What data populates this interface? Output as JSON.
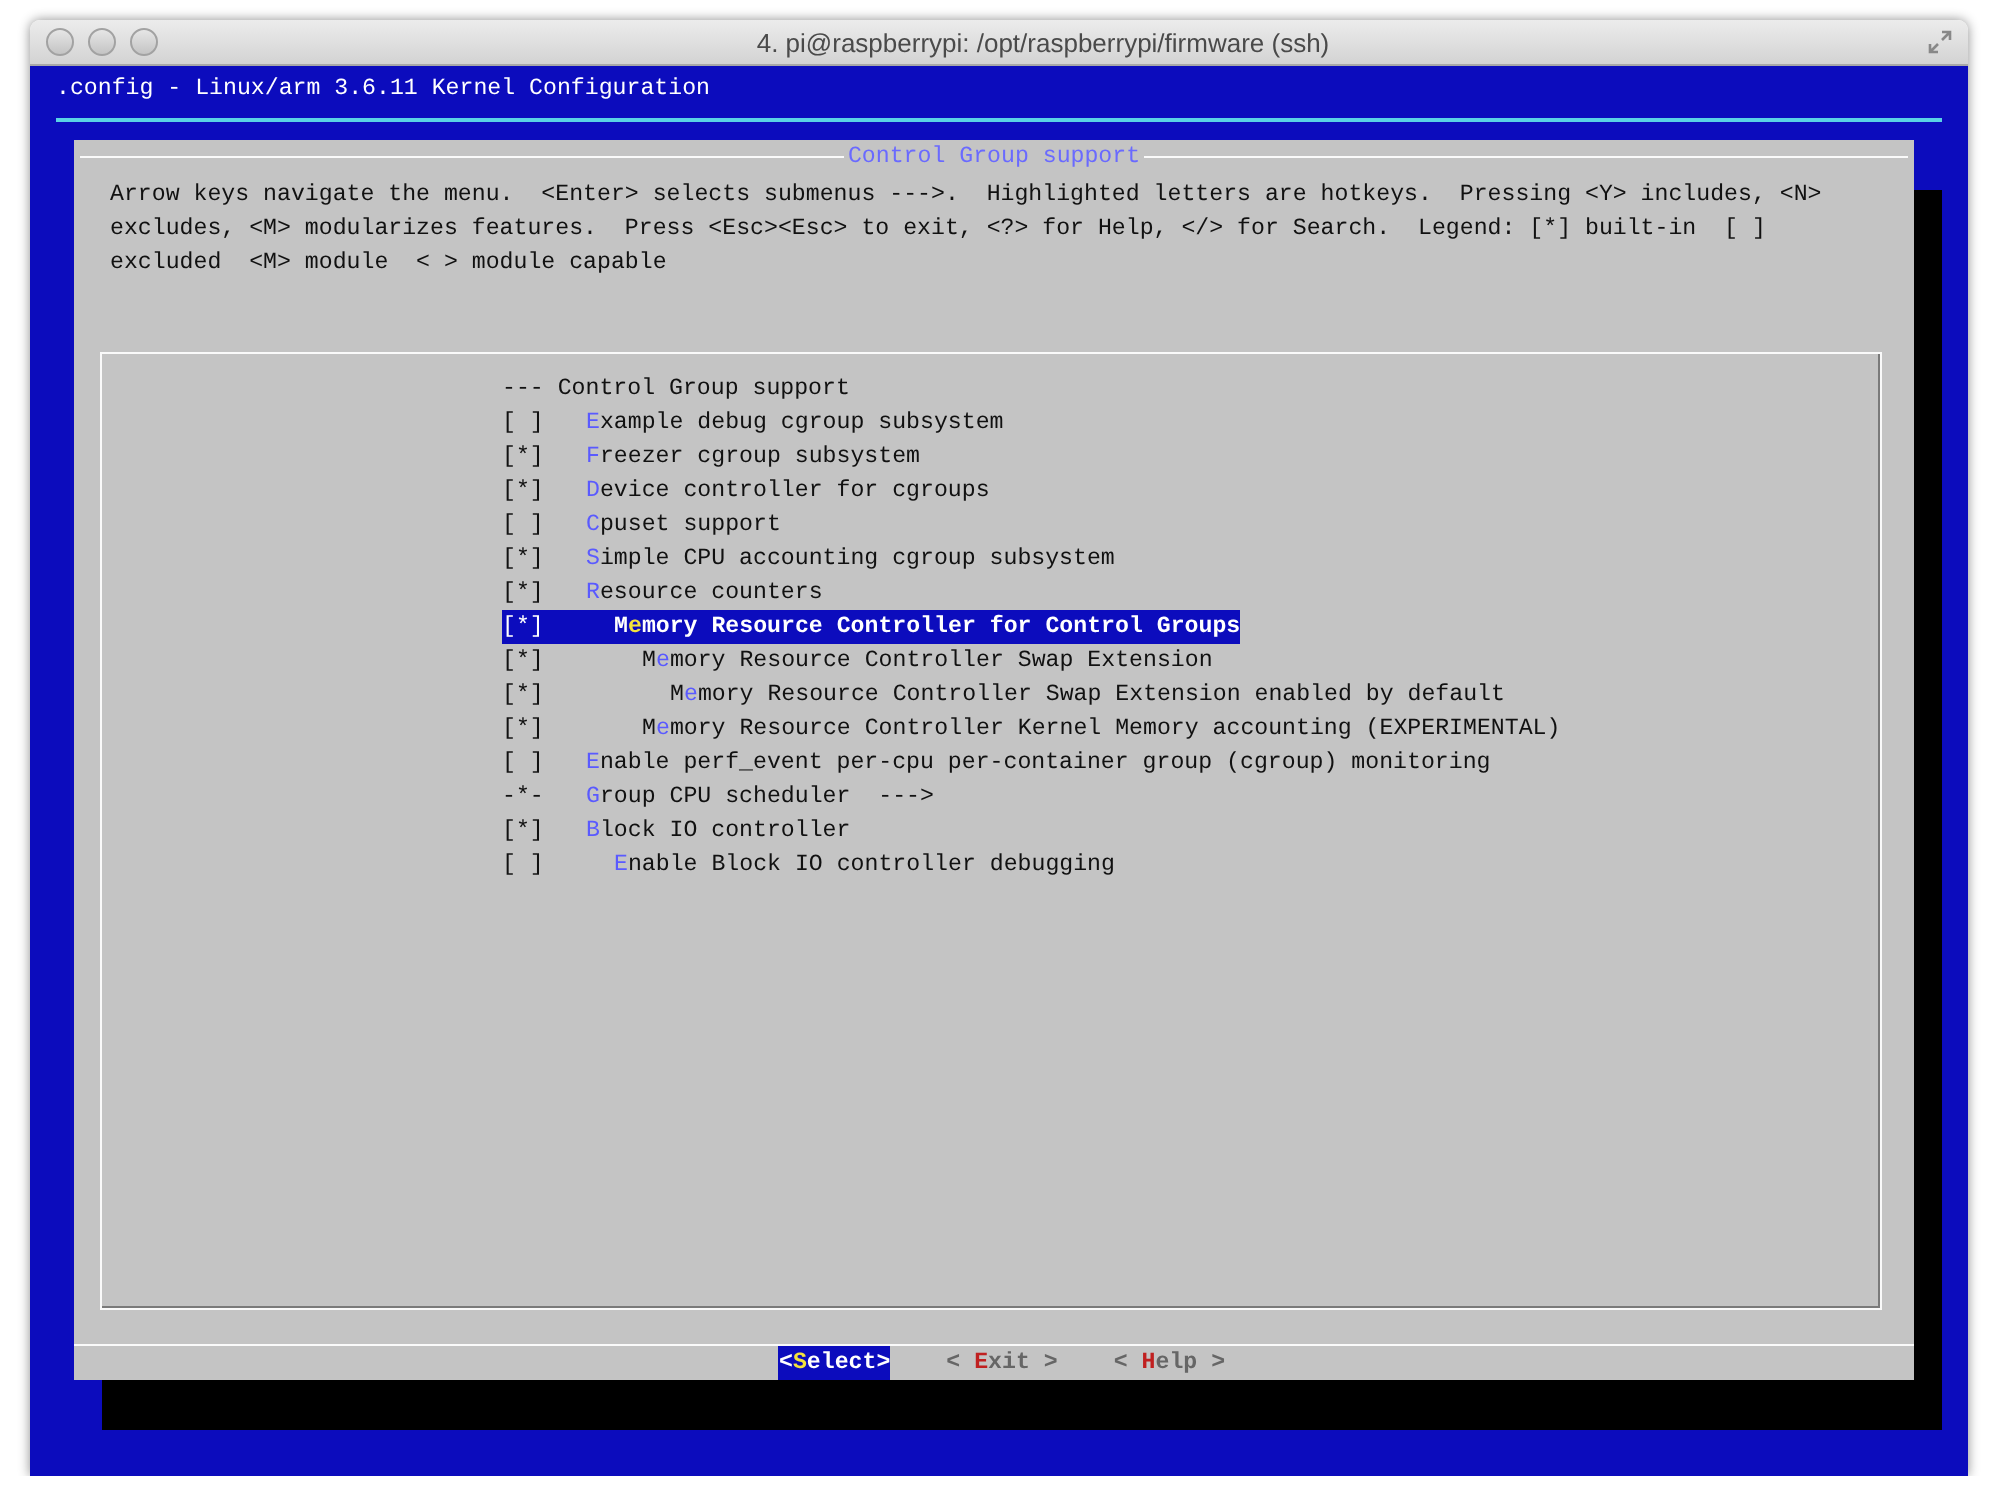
{
  "window": {
    "title": "4. pi@raspberrypi: /opt/raspberrypi/firmware (ssh)"
  },
  "header": ".config - Linux/arm 3.6.11 Kernel Configuration",
  "dialog": {
    "title": "Control Group support",
    "help": [
      "Arrow keys navigate the menu.  <Enter> selects submenus --->.  Highlighted letters are hotkeys.  Pressing <Y> includes, <N>",
      "excludes, <M> modularizes features.  Press <Esc><Esc> to exit, <?> for Help, </> for Search.  Legend: [*] built-in  [ ]",
      "excluded  <M> module  < > module capable"
    ],
    "menu": [
      {
        "mark": "---",
        "label": "Control Group support",
        "kind": "comment"
      },
      {
        "mark": "[ ]",
        "label": "**E**xample debug cgroup subsystem",
        "kind": "option",
        "selected": false
      },
      {
        "mark": "[*]",
        "label": "**F**reezer cgroup subsystem",
        "kind": "option",
        "selected": false
      },
      {
        "mark": "[*]",
        "label": "**D**evice controller for cgroups",
        "kind": "option",
        "selected": false
      },
      {
        "mark": "[ ]",
        "label": "**C**puset support",
        "kind": "option",
        "selected": false
      },
      {
        "mark": "[*]",
        "label": "**S**imple CPU accounting cgroup subsystem",
        "kind": "option",
        "selected": false
      },
      {
        "mark": "[*]",
        "label": "**R**esource counters",
        "kind": "option",
        "selected": false,
        "children": [
          {
            "mark": "[*]",
            "label": "M**e**mory Resource Controller for Control Groups",
            "kind": "option",
            "selected": true,
            "children": [
              {
                "mark": "[*]",
                "label": "M**e**mory Resource Controller Swap Extension",
                "kind": "option",
                "selected": false,
                "children": [
                  {
                    "mark": "[*]",
                    "label": "M**e**mory Resource Controller Swap Extension enabled by default",
                    "kind": "option",
                    "selected": false
                  }
                ]
              },
              {
                "mark": "[*]",
                "label": "M**e**mory Resource Controller Kernel Memory accounting (EXPERIMENTAL)",
                "kind": "option",
                "selected": false
              }
            ]
          }
        ]
      },
      {
        "mark": "[ ]",
        "label": "**E**nable perf_event per-cpu per-container group (cgroup) monitoring",
        "kind": "option",
        "selected": false
      },
      {
        "mark": "-*-",
        "label": "**G**roup CPU scheduler  --->",
        "kind": "option",
        "selected": false
      },
      {
        "mark": "[*]",
        "label": "**B**lock IO controller",
        "kind": "option",
        "selected": false,
        "children": [
          {
            "mark": "[ ]",
            "label": "**E**nable Block IO controller debugging",
            "kind": "option",
            "selected": false
          }
        ]
      }
    ],
    "buttons": [
      {
        "label": "<**S**elect>",
        "selected": true
      },
      {
        "label": "< **E**xit >",
        "selected": false
      },
      {
        "label": "< **H**elp >",
        "selected": false
      }
    ]
  }
}
